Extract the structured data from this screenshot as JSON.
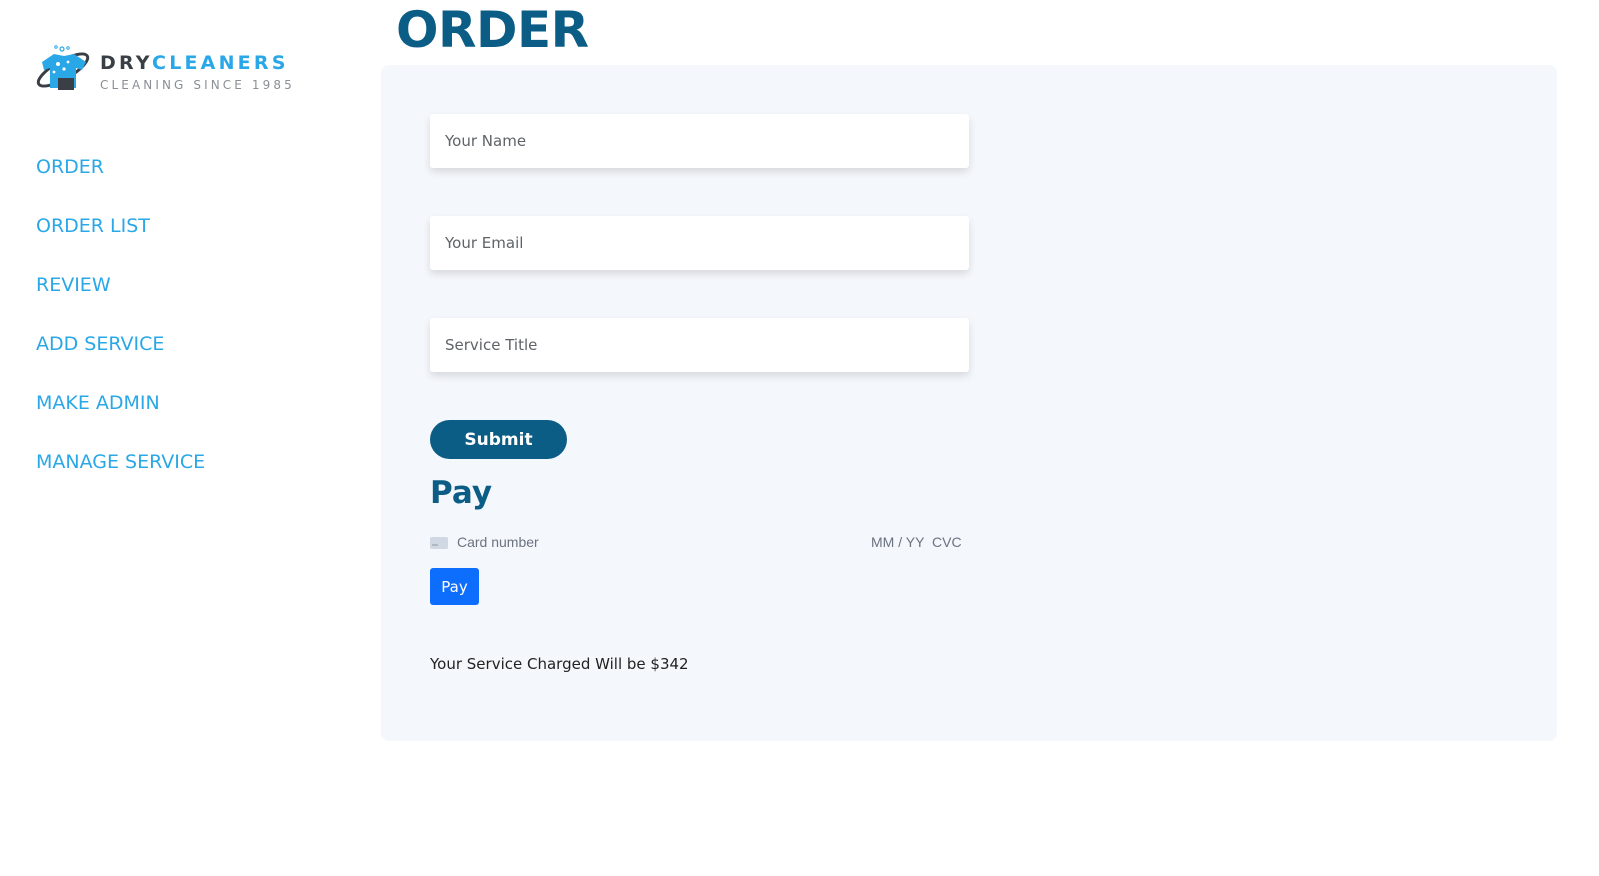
{
  "sidebar": {
    "brand": {
      "dry": "DRY",
      "cleaners": "CLEANERS",
      "tagline": "CLEANING SINCE 1985"
    },
    "items": [
      {
        "label": "ORDER"
      },
      {
        "label": "ORDER LIST"
      },
      {
        "label": "REVIEW"
      },
      {
        "label": "ADD SERVICE"
      },
      {
        "label": "MAKE ADMIN"
      },
      {
        "label": "MANAGE SERVICE"
      }
    ]
  },
  "main": {
    "title": "ORDER",
    "form": {
      "name_placeholder": "Your Name",
      "email_placeholder": "Your Email",
      "service_placeholder": "Service Title",
      "submit_label": "Submit"
    },
    "payment": {
      "heading": "Pay",
      "card_number_placeholder": "Card number",
      "expiry_placeholder": "MM / YY",
      "cvc_placeholder": "CVC",
      "pay_label": "Pay"
    },
    "charge_text": "Your Service Charged Will be $342"
  },
  "colors": {
    "accent": "#2aa7e6",
    "primary": "#0b5d86",
    "pay_button": "#0d6efd",
    "panel_bg": "#f4f7fb"
  },
  "icons": [
    "logo-icon",
    "credit-card-icon"
  ]
}
